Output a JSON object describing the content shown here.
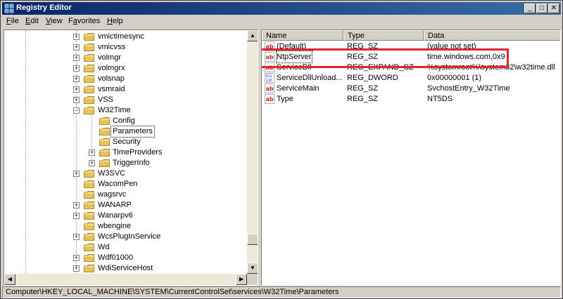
{
  "window": {
    "title": "Registry Editor",
    "controls": {
      "minimize": "_",
      "maximize": "□",
      "close": "✕"
    }
  },
  "menu": [
    {
      "label": "File",
      "mnemonic": "F",
      "rest": "ile"
    },
    {
      "label": "Edit",
      "mnemonic": "E",
      "rest": "dit"
    },
    {
      "label": "View",
      "mnemonic": "V",
      "rest": "iew"
    },
    {
      "label": "Favorites",
      "mnemonic": "a",
      "prefix": "F",
      "rest": "vorites"
    },
    {
      "label": "Help",
      "mnemonic": "H",
      "rest": "elp"
    }
  ],
  "tree": {
    "items": [
      {
        "label": "vmictimesync",
        "expander": "+",
        "level": 0
      },
      {
        "label": "vmicvss",
        "expander": "+",
        "level": 0
      },
      {
        "label": "volmgr",
        "expander": "+",
        "level": 0
      },
      {
        "label": "volmgrx",
        "expander": "+",
        "level": 0
      },
      {
        "label": "volsnap",
        "expander": "+",
        "level": 0
      },
      {
        "label": "vsmraid",
        "expander": "+",
        "level": 0
      },
      {
        "label": "VSS",
        "expander": "+",
        "level": 0
      },
      {
        "label": "W32Time",
        "expander": "−",
        "level": 0
      },
      {
        "label": "Config",
        "expander": "",
        "level": 1
      },
      {
        "label": "Parameters",
        "expander": "",
        "level": 1,
        "selected": true
      },
      {
        "label": "Security",
        "expander": "",
        "level": 1
      },
      {
        "label": "TimeProviders",
        "expander": "+",
        "level": 1
      },
      {
        "label": "TriggerInfo",
        "expander": "+",
        "level": 1
      },
      {
        "label": "W3SVC",
        "expander": "+",
        "level": 0
      },
      {
        "label": "WacomPen",
        "expander": "",
        "level": 0
      },
      {
        "label": "wagsrvc",
        "expander": "",
        "level": 0
      },
      {
        "label": "WANARP",
        "expander": "+",
        "level": 0
      },
      {
        "label": "Wanarpv6",
        "expander": "+",
        "level": 0
      },
      {
        "label": "wbengine",
        "expander": "",
        "level": 0
      },
      {
        "label": "WcsPlugInService",
        "expander": "+",
        "level": 0
      },
      {
        "label": "Wd",
        "expander": "",
        "level": 0
      },
      {
        "label": "Wdf01000",
        "expander": "+",
        "level": 0
      },
      {
        "label": "WdiServiceHost",
        "expander": "+",
        "level": 0
      }
    ]
  },
  "list": {
    "columns": [
      "Name",
      "Type",
      "Data"
    ],
    "rows": [
      {
        "icon": "ab",
        "name": "(Default)",
        "type": "REG_SZ",
        "data": "(value not set)"
      },
      {
        "icon": "ab",
        "name": "NtpServer",
        "type": "REG_SZ",
        "data": "time.windows.com,0x9",
        "highlighted": true
      },
      {
        "icon": "ab",
        "name": "ServiceDll",
        "type": "REG_EXPAND_SZ",
        "data": "%systemroot%\\system32\\w32time.dll"
      },
      {
        "icon": "bin",
        "name": "ServiceDllUnload...",
        "type": "REG_DWORD",
        "data": "0x00000001 (1)"
      },
      {
        "icon": "ab",
        "name": "ServiceMain",
        "type": "REG_SZ",
        "data": "SvchostEntry_W32Time"
      },
      {
        "icon": "ab",
        "name": "Type",
        "type": "REG_SZ",
        "data": "NT5DS"
      }
    ]
  },
  "status": {
    "path": "Computer\\HKEY_LOCAL_MACHINE\\SYSTEM\\CurrentControlSet\\services\\W32Time\\Parameters"
  },
  "colors": {
    "highlight_box": "#e8222c",
    "folder": "#e8c35a",
    "titlebar": "#0a246a"
  }
}
